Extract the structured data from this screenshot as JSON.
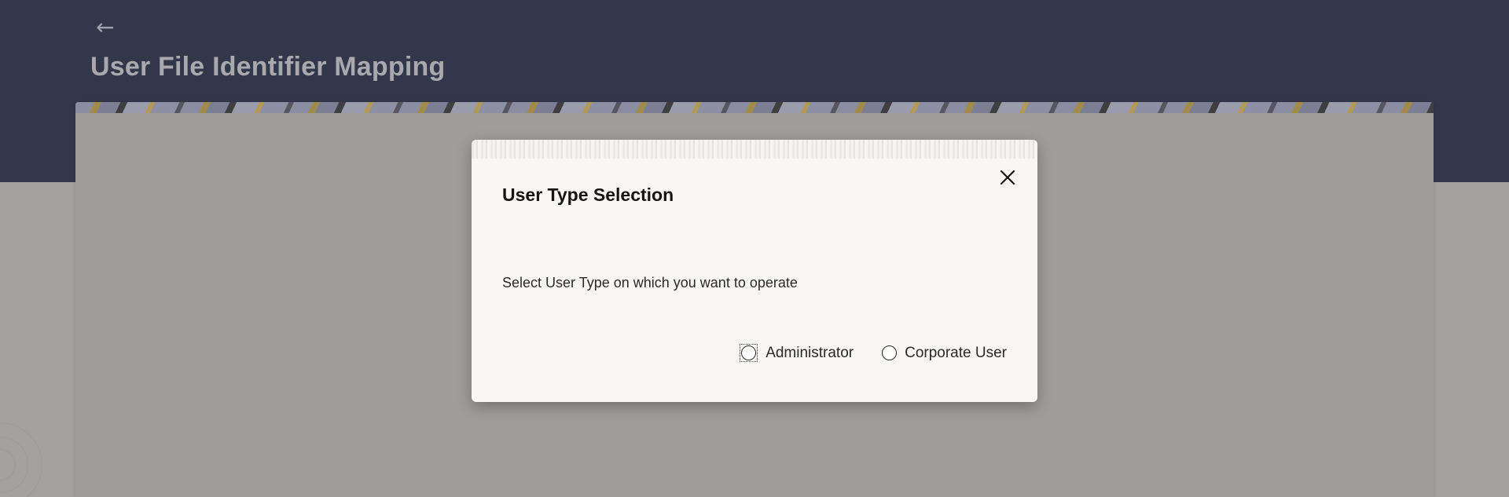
{
  "header": {
    "back_icon": "arrow-left-icon",
    "back_glyph": "←",
    "title": "User File Identifier Mapping"
  },
  "modal": {
    "title": "User Type Selection",
    "close_icon": "close-icon",
    "message": "Select User Type on which you want to operate",
    "options": [
      {
        "label": "Administrator",
        "selected": false,
        "focused": true
      },
      {
        "label": "Corporate User",
        "selected": false,
        "focused": false
      }
    ]
  },
  "colors": {
    "header_bg": "#33374a",
    "overlay_tone": "#9e9d9b",
    "modal_bg": "#f8f7f5",
    "text_dark": "#161513"
  }
}
